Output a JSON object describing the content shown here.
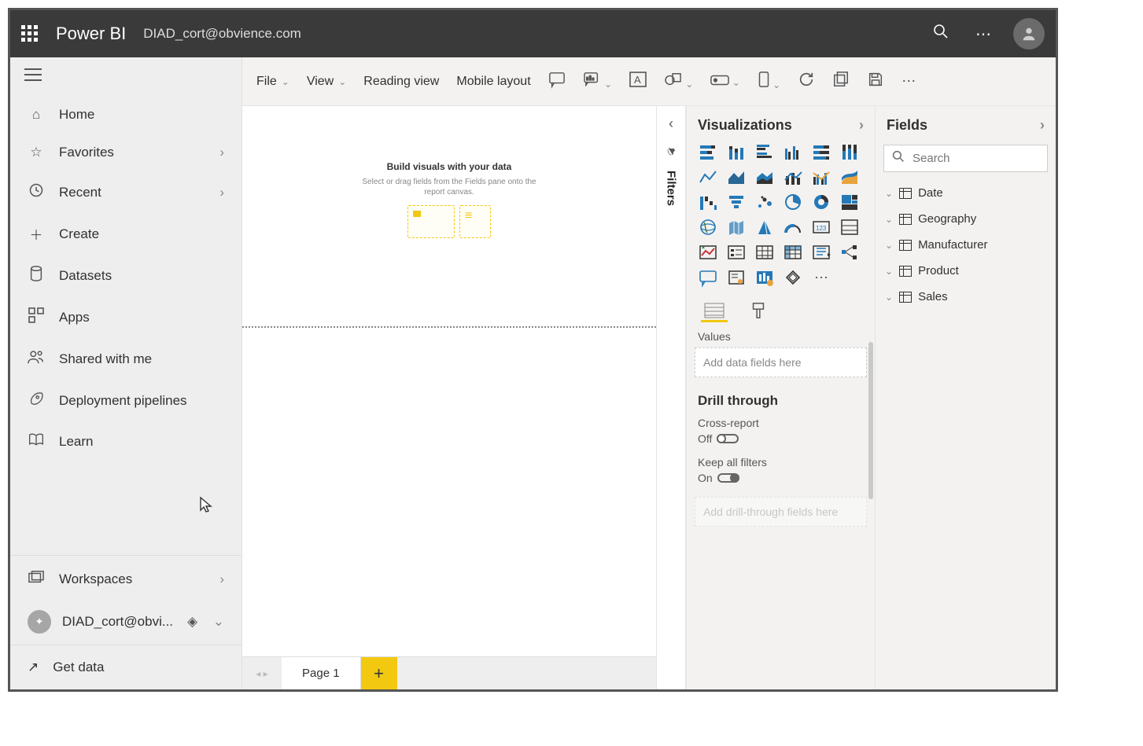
{
  "header": {
    "brand": "Power BI",
    "account": "DIAD_cort@obvience.com"
  },
  "left_nav": {
    "items": [
      {
        "icon": "home-icon",
        "label": "Home",
        "chevron": false
      },
      {
        "icon": "star-icon",
        "label": "Favorites",
        "chevron": true
      },
      {
        "icon": "clock-icon",
        "label": "Recent",
        "chevron": true
      },
      {
        "icon": "plus-icon",
        "label": "Create",
        "chevron": false
      },
      {
        "icon": "cylinder-icon",
        "label": "Datasets",
        "chevron": false
      },
      {
        "icon": "apps-icon",
        "label": "Apps",
        "chevron": false
      },
      {
        "icon": "people-icon",
        "label": "Shared with me",
        "chevron": false
      },
      {
        "icon": "rocket-icon",
        "label": "Deployment pipelines",
        "chevron": false
      },
      {
        "icon": "book-icon",
        "label": "Learn",
        "chevron": false
      }
    ],
    "workspaces_label": "Workspaces",
    "current_workspace": "DIAD_cort@obvi...",
    "get_data": "Get data"
  },
  "ribbon": {
    "file": "File",
    "view": "View",
    "reading_view": "Reading view",
    "mobile_layout": "Mobile layout"
  },
  "canvas_placeholder": {
    "title": "Build visuals with your data",
    "subtitle": "Select or drag fields from the Fields pane onto the report canvas."
  },
  "page_tabs": {
    "page1": "Page 1"
  },
  "filters_label": "Filters",
  "viz_pane": {
    "title": "Visualizations",
    "values_label": "Values",
    "values_placeholder": "Add data fields here",
    "drill_title": "Drill through",
    "cross_report_label": "Cross-report",
    "cross_report_state": "Off",
    "keep_filters_label": "Keep all filters",
    "keep_filters_state": "On",
    "drill_placeholder": "Add drill-through fields here"
  },
  "fields_pane": {
    "title": "Fields",
    "search_placeholder": "Search",
    "tables": [
      "Date",
      "Geography",
      "Manufacturer",
      "Product",
      "Sales"
    ]
  }
}
